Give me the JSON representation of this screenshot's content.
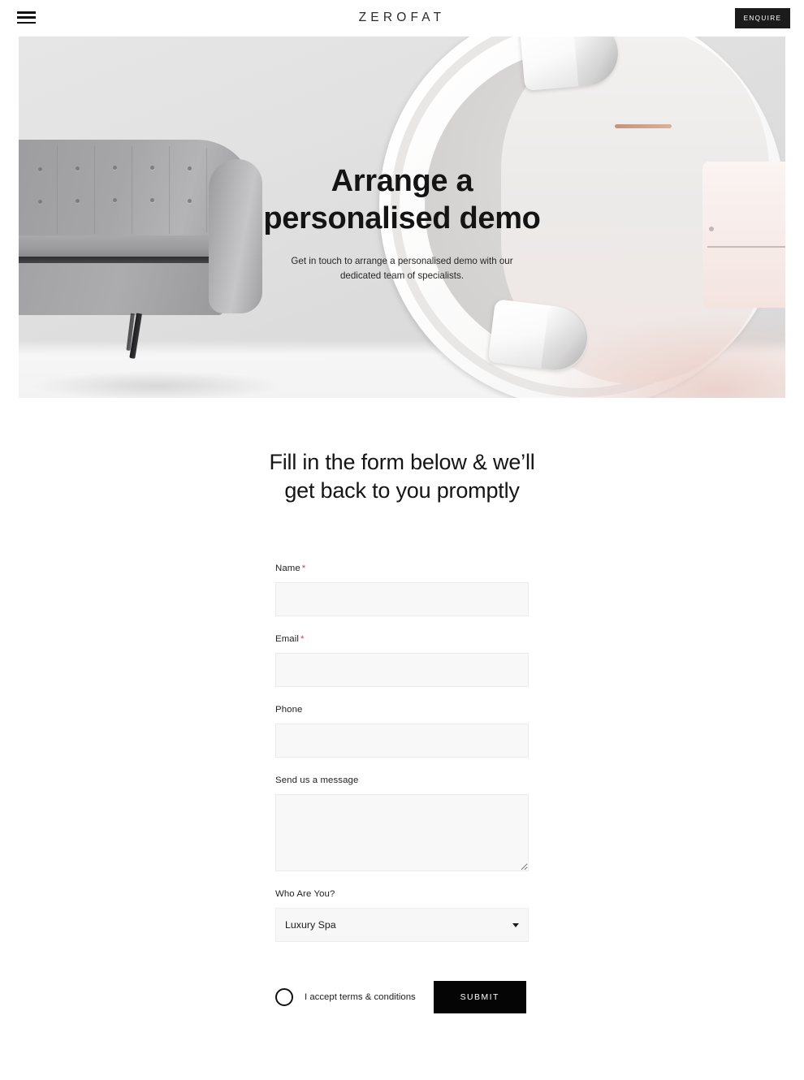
{
  "header": {
    "menu_icon": "hamburger-menu-icon",
    "brand": "ZEROFAT",
    "enquire_label": "ENQUIRE"
  },
  "hero": {
    "title_line1": "Arrange a",
    "title_line2": "personalised demo",
    "subtitle": "Get in touch to arrange a personalised demo with our dedicated team of specialists.",
    "image_description": "grey tufted sofa beside a white circular body-contouring machine"
  },
  "form": {
    "heading_line1": "Fill in the form below & we’ll",
    "heading_line2": "get back to you promptly",
    "required_marker": "*",
    "fields": [
      {
        "label": "Name",
        "required": true,
        "value": "",
        "placeholder": ""
      },
      {
        "label": "Email",
        "required": true,
        "value": "",
        "placeholder": ""
      },
      {
        "label": "Phone",
        "required": false,
        "value": "",
        "placeholder": ""
      },
      {
        "label": "Send us a message",
        "required": false,
        "value": "",
        "placeholder": ""
      }
    ],
    "select": {
      "label": "Who Are You?",
      "selected": "Luxury Spa",
      "options": [
        "Luxury Spa"
      ],
      "caret_icon": "chevron-down-icon"
    },
    "terms_label": "I accept terms & conditions",
    "terms_checked": false,
    "submit_label": "SUBMIT"
  },
  "colors": {
    "accent_dark": "#050505",
    "required_red": "#e0344b",
    "input_bg": "#f8f8f8",
    "page_bg": "#ffffff"
  }
}
